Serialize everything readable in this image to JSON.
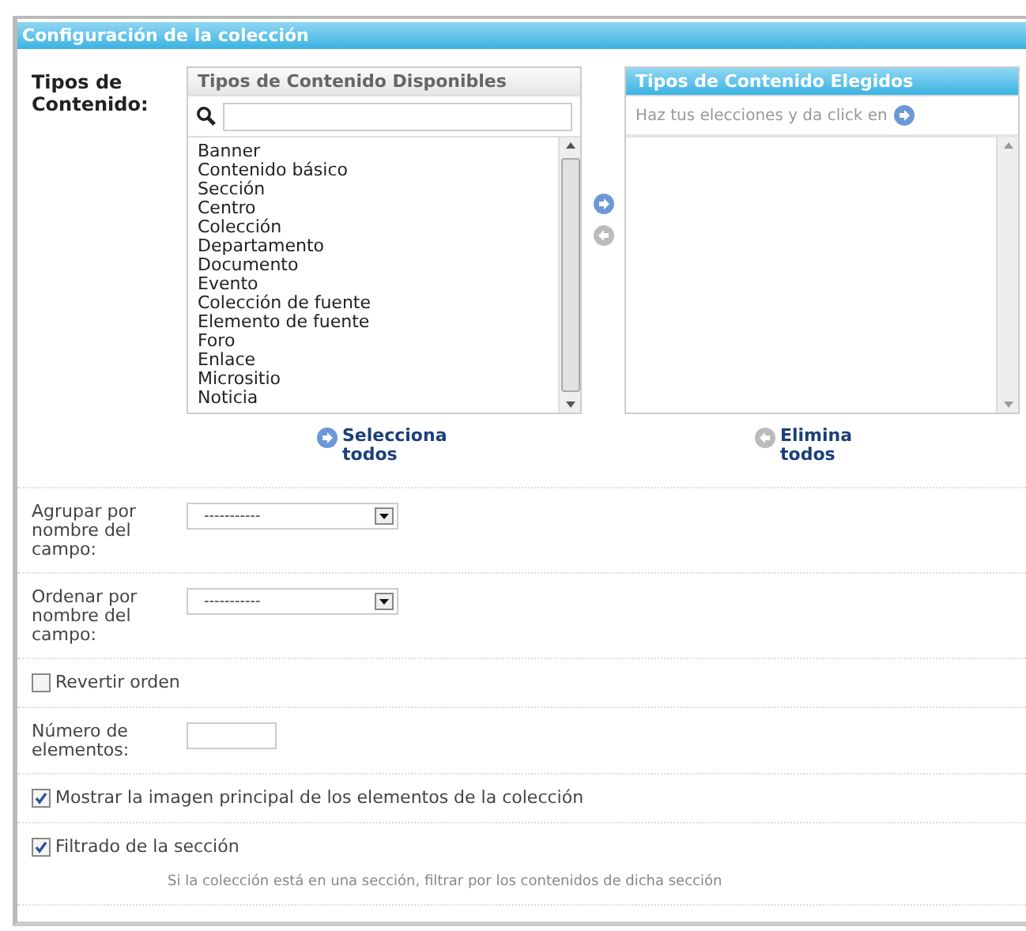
{
  "panel": {
    "title": "Configuración de la colección"
  },
  "content_types": {
    "label": "Tipos de Contenido:",
    "available": {
      "title": "Tipos de Contenido Disponibles",
      "search": {
        "kind": "text"
      },
      "items": [
        "Banner",
        "Contenido básico",
        "Sección",
        "Centro",
        "Colección",
        "Departamento",
        "Documento",
        "Evento",
        "Colección de fuente",
        "Elemento de fuente",
        "Foro",
        "Enlace",
        "Micrositio",
        "Noticia"
      ],
      "select_all": "Selecciona todos"
    },
    "chosen": {
      "title": "Tipos de Contenido Elegidos",
      "hint": "Haz tus elecciones y da click en",
      "remove_all": "Elimina todos"
    }
  },
  "fields": [
    {
      "kind": "select",
      "label": "Agrupar por nombre del campo:",
      "value": "-----------"
    },
    {
      "kind": "select",
      "label": "Ordenar por nombre del campo:",
      "value": "-----------"
    },
    {
      "kind": "checkbox",
      "label": "Revertir orden",
      "checked": false
    },
    {
      "kind": "text",
      "label": "Número de elementos:"
    },
    {
      "kind": "checkbox",
      "label": "Mostrar la imagen principal de los elementos de la colección",
      "checked": true
    },
    {
      "kind": "checkbox",
      "label": "Filtrado de la sección",
      "checked": true,
      "help": "Si la colección está en una sección, filtrar por los contenidos de dicha sección"
    }
  ]
}
